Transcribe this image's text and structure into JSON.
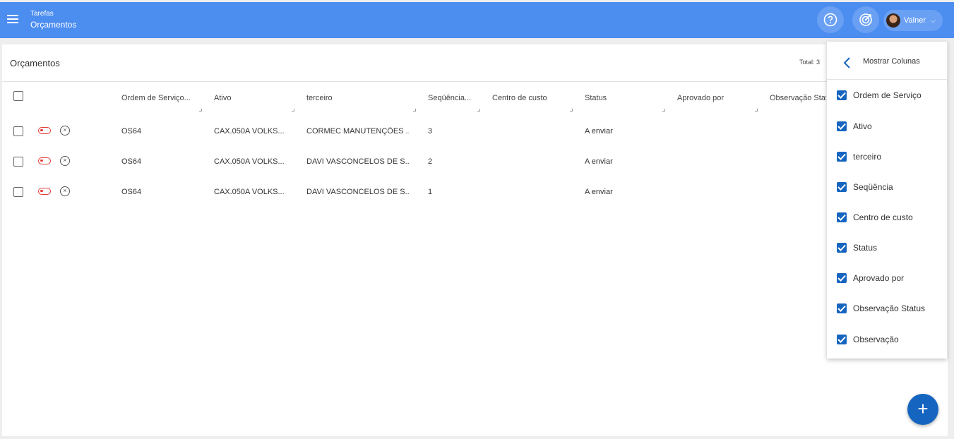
{
  "header": {
    "breadcrumb": "Tarefas",
    "title": "Orçamentos",
    "help_icon": "help-circle-icon",
    "target_icon": "target-icon",
    "user_name": "Valner",
    "chevron": "⌵"
  },
  "page": {
    "title": "Orçamentos",
    "total": "Total: 3"
  },
  "table": {
    "columns": [
      "Ordem de Serviço...",
      "Ativo",
      "terceiro",
      "Seqüência...",
      "Centro de custo",
      "Status",
      "Aprovado por",
      "Observação Stat"
    ],
    "rows": [
      [
        "OS64",
        "CAX.050A VOLKS...",
        "CORMEC MANUTENÇÕES ...",
        "3",
        "",
        "A enviar",
        "",
        ""
      ],
      [
        "OS64",
        "CAX.050A VOLKS...",
        "DAVI VASCONCELOS DE S...",
        "2",
        "",
        "A enviar",
        "",
        ""
      ],
      [
        "OS64",
        "CAX.050A VOLKS...",
        "DAVI VASCONCELOS DE S...",
        "1",
        "",
        "A enviar",
        "",
        ""
      ]
    ],
    "remove_glyph": "×"
  },
  "column_menu": {
    "title": "Mostrar Colunas",
    "options": [
      {
        "label": "Ordem de Serviço",
        "checked": true
      },
      {
        "label": "Ativo",
        "checked": true
      },
      {
        "label": "terceiro",
        "checked": true
      },
      {
        "label": "Seqüência",
        "checked": true
      },
      {
        "label": "Centro de custo",
        "checked": true
      },
      {
        "label": "Status",
        "checked": true
      },
      {
        "label": "Aprovado por",
        "checked": true
      },
      {
        "label": "Observação Status",
        "checked": true
      },
      {
        "label": "Observação",
        "checked": true
      }
    ]
  },
  "fab": {
    "label": "+"
  },
  "colors": {
    "topbar": "#4c8df0",
    "accent": "#1565c0",
    "toggle": "#e53935"
  }
}
